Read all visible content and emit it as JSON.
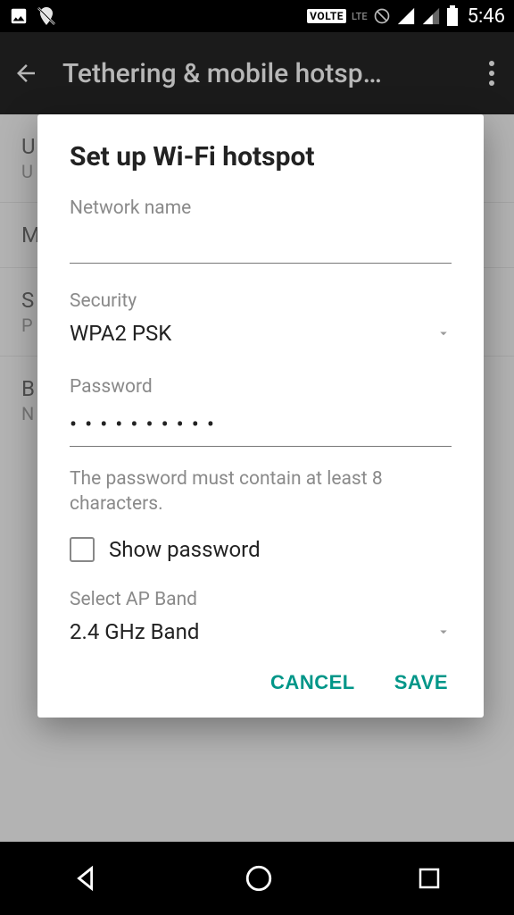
{
  "status": {
    "volte": "VOLTE",
    "lte": "LTE",
    "clock": "5:46"
  },
  "appbar": {
    "title": "Tethering & mobile hotsp…"
  },
  "background": {
    "rows": [
      {
        "title": "U",
        "sub": "U"
      },
      {
        "title": "M",
        "sub": ""
      },
      {
        "title": "S",
        "sub": "P"
      },
      {
        "title": "B",
        "sub": "N c"
      }
    ]
  },
  "dialog": {
    "title": "Set up Wi-Fi hotspot",
    "network_name_label": "Network name",
    "network_name_value": "",
    "security_label": "Security",
    "security_value": "WPA2 PSK",
    "password_label": "Password",
    "password_masked": "••••••••••",
    "password_hint": "The password must contain at least 8 characters.",
    "show_password_label": "Show password",
    "show_password_checked": false,
    "ap_band_label": "Select AP Band",
    "ap_band_value": "2.4 GHz Band",
    "cancel": "CANCEL",
    "save": "SAVE"
  }
}
